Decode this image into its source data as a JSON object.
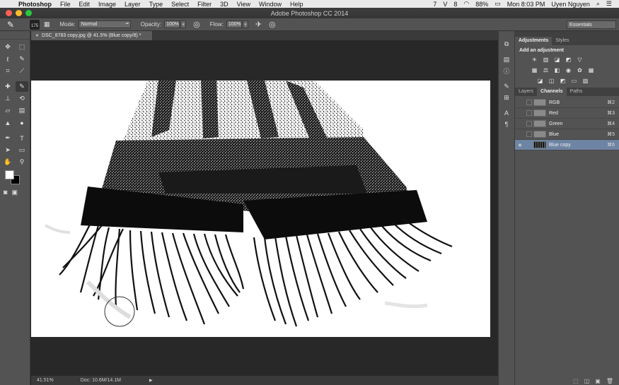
{
  "menubar": {
    "items": [
      "Photoshop",
      "File",
      "Edit",
      "Image",
      "Layer",
      "Type",
      "Select",
      "Filter",
      "3D",
      "View",
      "Window",
      "Help"
    ],
    "status_icons": [
      "7",
      "V",
      "8"
    ],
    "battery": "88%",
    "datetime": "Mon 8:03 PM",
    "user": "Uyen Nguyen"
  },
  "window": {
    "title": "Adobe Photoshop CC 2014"
  },
  "options": {
    "brush_size": "175",
    "mode_label": "Mode:",
    "mode_value": "Normal",
    "opacity_label": "Opacity:",
    "opacity_value": "100%",
    "flow_label": "Flow:",
    "flow_value": "100%",
    "workspace": "Essentials"
  },
  "document": {
    "tab_title": "DSC_8783 copy.jpg @ 41.5% (Blue copy/8) *",
    "zoom": "41.51%",
    "doc_info": "Doc: 10.6M/14.1M"
  },
  "adjustments": {
    "tabs": [
      "Adjustments",
      "Styles"
    ],
    "heading": "Add an adjustment"
  },
  "channels_panel": {
    "tabs": [
      "Layers",
      "Channels",
      "Paths"
    ],
    "channels": [
      {
        "name": "RGB",
        "shortcut": "⌘2",
        "selected": false
      },
      {
        "name": "Red",
        "shortcut": "⌘3",
        "selected": false
      },
      {
        "name": "Green",
        "shortcut": "⌘4",
        "selected": false
      },
      {
        "name": "Blue",
        "shortcut": "⌘5",
        "selected": false
      },
      {
        "name": "Blue copy",
        "shortcut": "⌘6",
        "selected": true
      }
    ]
  },
  "colors": {
    "accent_selected": "#6e84a3",
    "panel_bg": "#535353",
    "canvas_bg": "#282828"
  }
}
